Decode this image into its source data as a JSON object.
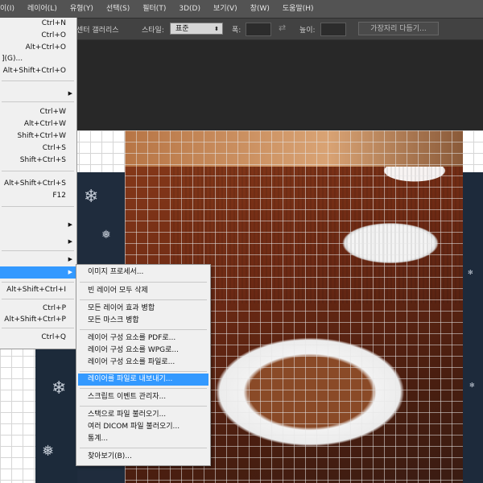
{
  "menubar": {
    "items": [
      "이(I)",
      "레이어(L)",
      "유형(Y)",
      "선택(S)",
      "필터(T)",
      "3D(D)",
      "보기(V)",
      "창(W)",
      "도움말(H)"
    ]
  },
  "options_bar": {
    "gallery_label": "센터 갤러리스",
    "style_label": "스타일:",
    "style_value": "표준",
    "width_label": "폭:",
    "height_label": "높이:",
    "refine_edge_label": "가장자리 다듬기..."
  },
  "file_menu": {
    "items": [
      {
        "label": "",
        "shortcut": "Ctrl+N"
      },
      {
        "label": "",
        "shortcut": "Ctrl+O"
      },
      {
        "label": "",
        "shortcut": "Alt+Ctrl+O"
      },
      {
        "label": "](G)...",
        "shortcut": ""
      },
      {
        "label": "",
        "shortcut": "Alt+Shift+Ctrl+O"
      },
      {
        "label": "",
        "shortcut": "Ctrl+W"
      },
      {
        "label": "",
        "shortcut": "Alt+Ctrl+W"
      },
      {
        "label": "",
        "shortcut": "Shift+Ctrl+W"
      },
      {
        "label": "",
        "shortcut": "Ctrl+S"
      },
      {
        "label": "",
        "shortcut": "Shift+Ctrl+S"
      },
      {
        "label": "",
        "shortcut": "Alt+Shift+Ctrl+S"
      },
      {
        "label": "",
        "shortcut": "F12"
      },
      {
        "label": "",
        "shortcut": "Alt+Shift+Ctrl+I"
      },
      {
        "label": "",
        "shortcut": "Ctrl+P"
      },
      {
        "label": "",
        "shortcut": "Alt+Shift+Ctrl+P"
      },
      {
        "label": "",
        "shortcut": "Ctrl+Q"
      }
    ]
  },
  "scripts_submenu": {
    "items": [
      {
        "label": "이미지 프로세서..."
      },
      {
        "label": "빈 레이어 모두 삭제"
      },
      {
        "label": "모든 레이어 효과 병합"
      },
      {
        "label": "모든 마스크 병합"
      },
      {
        "label": "레이어 구성 요소를 PDF로..."
      },
      {
        "label": "레이어 구성 요소를 WPG로..."
      },
      {
        "label": "레이어 구성 요소를 파일로..."
      },
      {
        "label": "레이어를 파일로 내보내기..."
      },
      {
        "label": "스크립트 이벤트 관리자..."
      },
      {
        "label": "스택으로 파일 불러오기..."
      },
      {
        "label": "여러 DICOM 파일 불러오기..."
      },
      {
        "label": "통계..."
      },
      {
        "label": "찾아보기(B)..."
      }
    ],
    "highlighted": "레이어를 파일로 내보내기..."
  },
  "colors": {
    "menubar_bg": "#535353",
    "menu_bg": "#f0f0f0",
    "highlight": "#3399ff",
    "workspace_bg": "#282828"
  }
}
